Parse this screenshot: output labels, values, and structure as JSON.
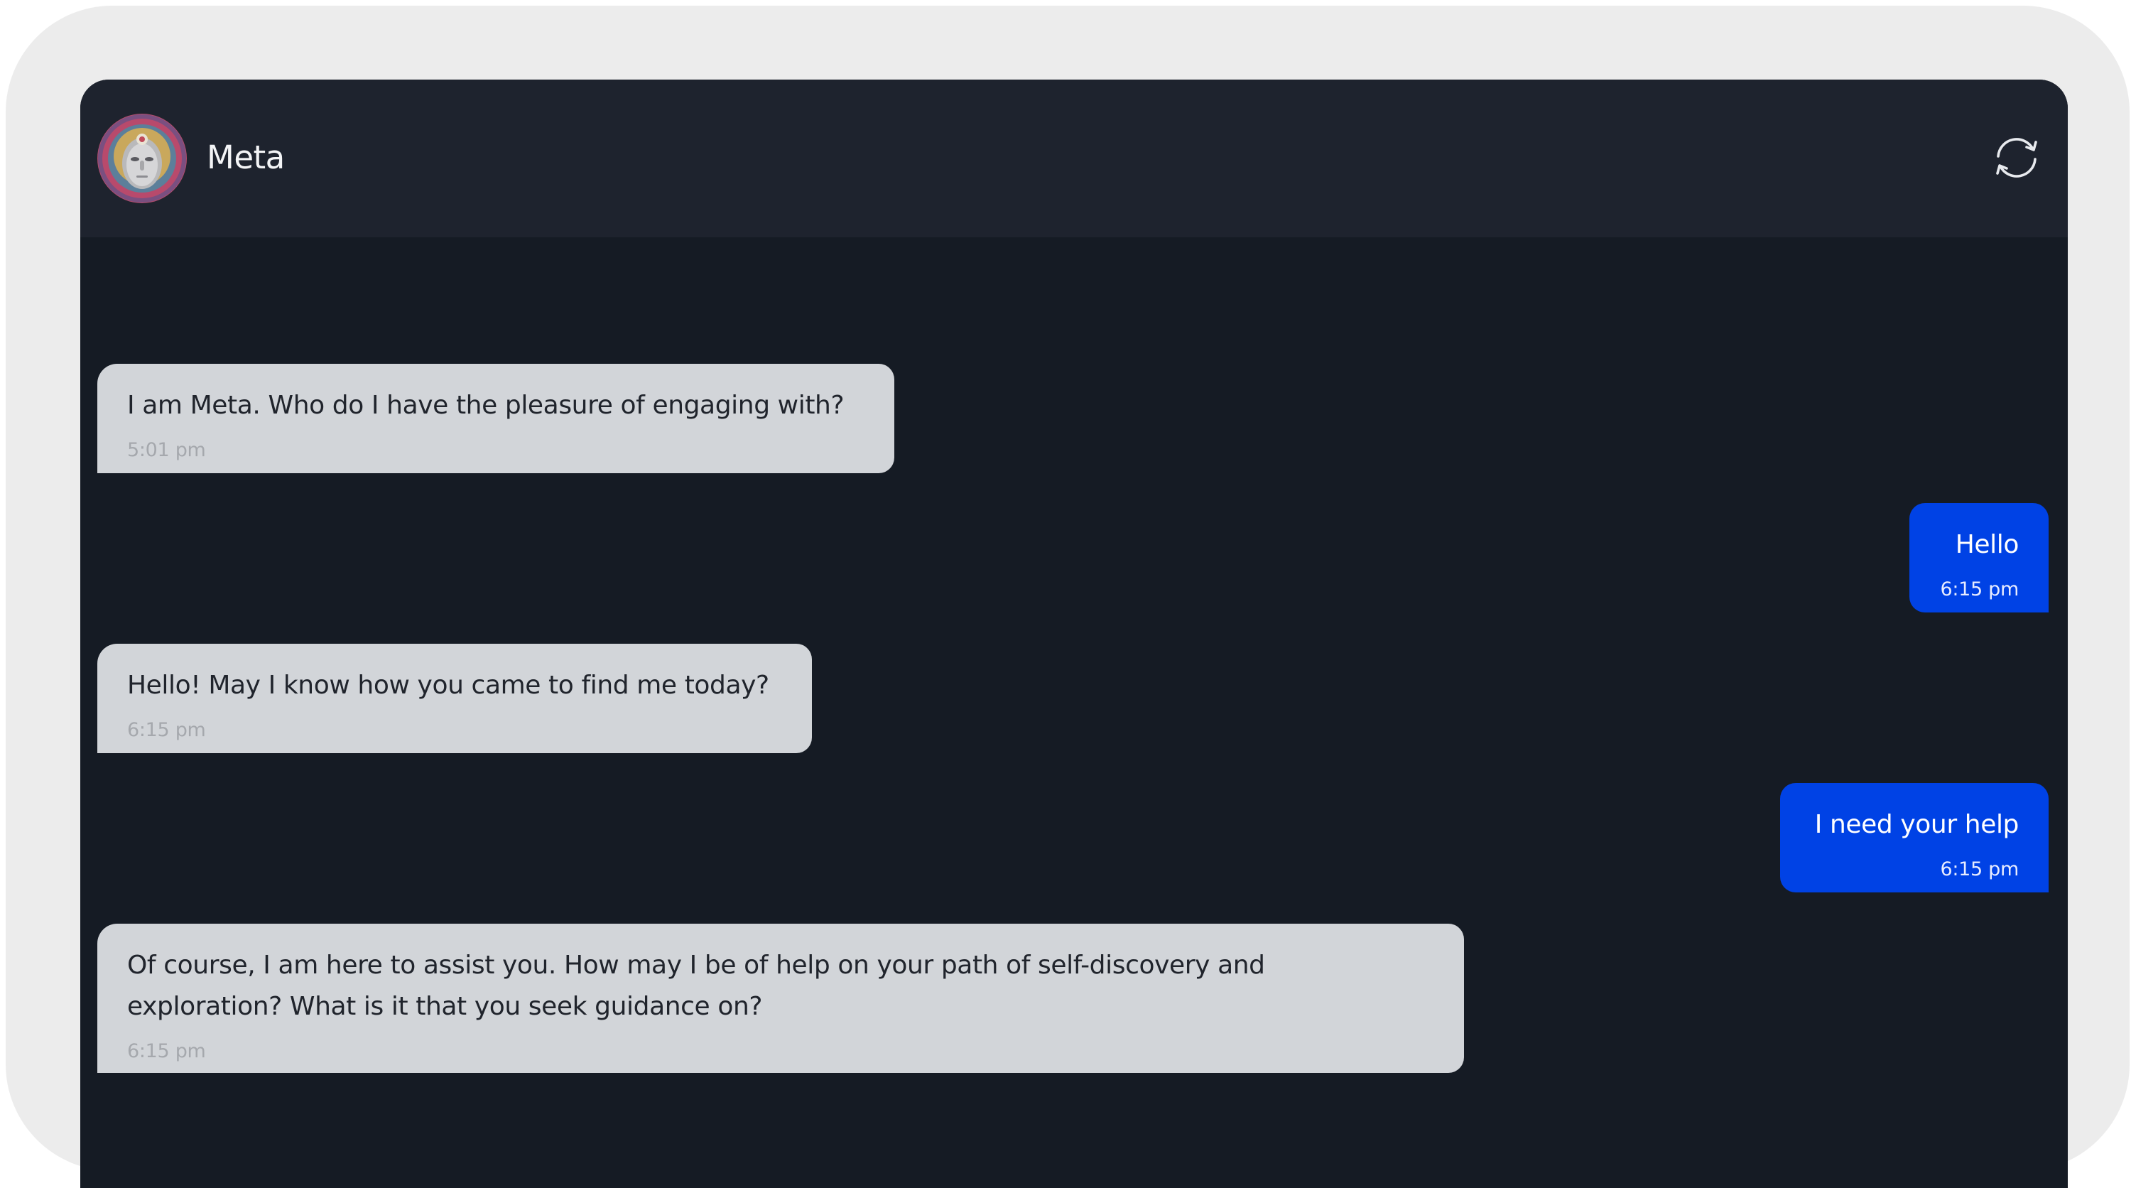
{
  "header": {
    "assistant_name": "Meta",
    "avatar_icon": "avatar-icon",
    "refresh_icon": "refresh-icon"
  },
  "colors": {
    "background": "#151b24",
    "header": "#1e232e",
    "bot_bubble": "#d2d5d9",
    "user_bubble": "#0042e5",
    "frame": "#ececec"
  },
  "messages": [
    {
      "sender": "bot",
      "text": "I am Meta. Who do I have the pleasure of engaging with?",
      "time": "5:01 pm"
    },
    {
      "sender": "user",
      "text": "Hello",
      "time": "6:15 pm"
    },
    {
      "sender": "bot",
      "text": "Hello! May I know how you came to find me today?",
      "time": "6:15 pm"
    },
    {
      "sender": "user",
      "text": "I need your help",
      "time": "6:15 pm"
    },
    {
      "sender": "bot",
      "text": "Of course, I am here to assist you. How may I be of help on your path of self-discovery and\nexploration? What is it that you seek guidance on?",
      "time": "6:15 pm"
    }
  ]
}
